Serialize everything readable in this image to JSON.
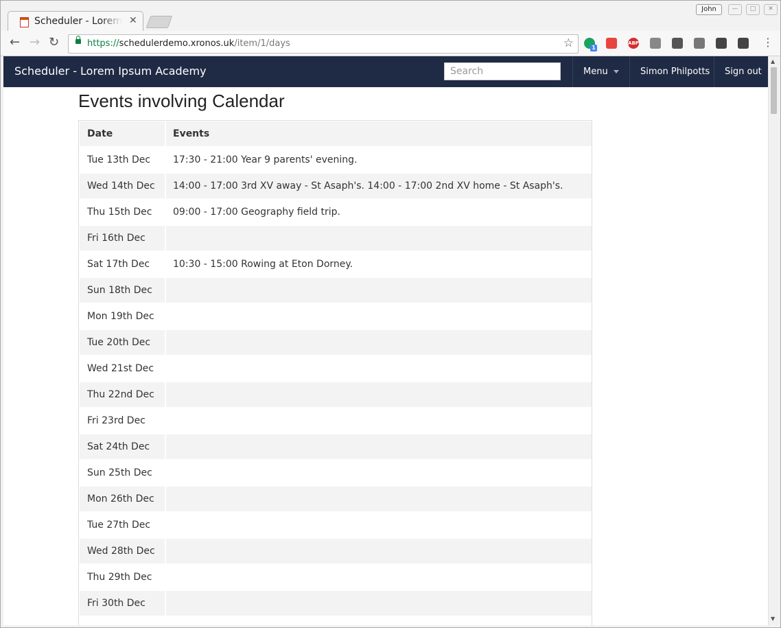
{
  "browser": {
    "tab_title": "Scheduler - Lorem Ipsum Academy",
    "close_glyph": "✕",
    "profile_name": "John",
    "url_scheme": "https://",
    "url_host": "schedulerdemo.xronos.uk",
    "url_path": "/item/1/days",
    "extension_badge": "1",
    "abp_label": "ABP",
    "icons": [
      "back-arrow-icon",
      "forward-arrow-icon",
      "reload-icon",
      "lock-icon",
      "bookmark-star-icon",
      "menu-dots-icon"
    ]
  },
  "app": {
    "brand": "Scheduler - Lorem Ipsum Academy",
    "search_placeholder": "Search",
    "menu_label": "Menu",
    "user_name": "Simon Philpotts",
    "sign_out_label": "Sign out",
    "accent_color": "#1f2a44"
  },
  "page": {
    "title": "Events involving Calendar"
  },
  "table": {
    "headers": {
      "date": "Date",
      "events": "Events"
    },
    "rows": [
      {
        "date": "Tue 13th Dec",
        "events": "17:30 - 21:00 Year 9 parents' evening."
      },
      {
        "date": "Wed 14th Dec",
        "events": "14:00 - 17:00 3rd XV away - St Asaph's. 14:00 - 17:00 2nd XV home - St Asaph's."
      },
      {
        "date": "Thu 15th Dec",
        "events": "09:00 - 17:00 Geography field trip."
      },
      {
        "date": "Fri 16th Dec",
        "events": ""
      },
      {
        "date": "Sat 17th Dec",
        "events": "10:30 - 15:00 Rowing at Eton Dorney."
      },
      {
        "date": "Sun 18th Dec",
        "events": ""
      },
      {
        "date": "Mon 19th Dec",
        "events": ""
      },
      {
        "date": "Tue 20th Dec",
        "events": ""
      },
      {
        "date": "Wed 21st Dec",
        "events": ""
      },
      {
        "date": "Thu 22nd Dec",
        "events": ""
      },
      {
        "date": "Fri 23rd Dec",
        "events": ""
      },
      {
        "date": "Sat 24th Dec",
        "events": ""
      },
      {
        "date": "Sun 25th Dec",
        "events": ""
      },
      {
        "date": "Mon 26th Dec",
        "events": ""
      },
      {
        "date": "Tue 27th Dec",
        "events": ""
      },
      {
        "date": "Wed 28th Dec",
        "events": ""
      },
      {
        "date": "Thu 29th Dec",
        "events": ""
      },
      {
        "date": "Fri 30th Dec",
        "events": ""
      }
    ]
  }
}
